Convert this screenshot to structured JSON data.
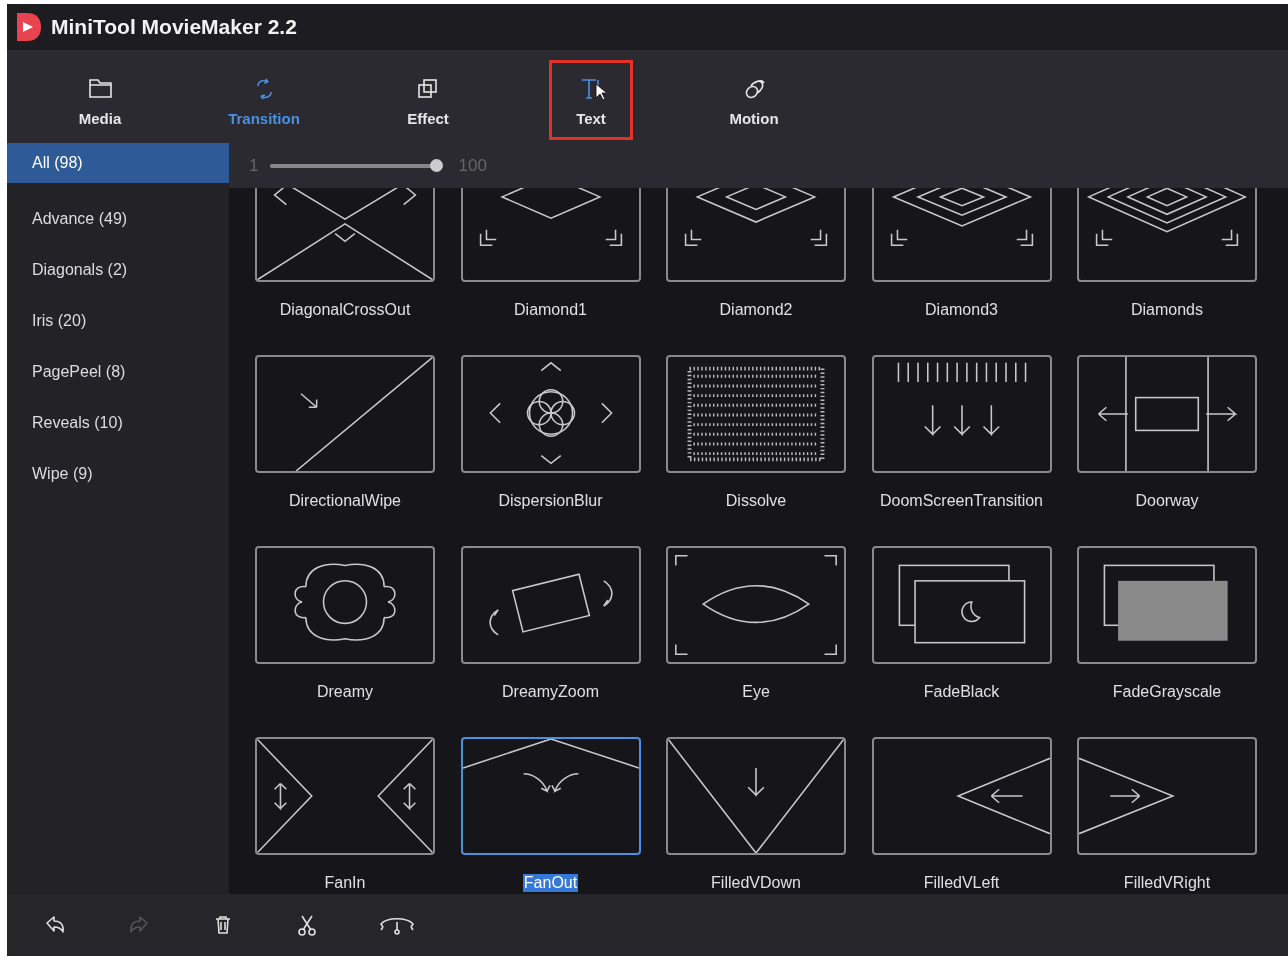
{
  "window": {
    "title": "MiniTool MovieMaker 2.2"
  },
  "tabs": [
    {
      "label": "Media",
      "kind": "folder",
      "selected": false,
      "highlighted": false
    },
    {
      "label": "Transition",
      "kind": "transition",
      "selected": true,
      "highlighted": false
    },
    {
      "label": "Effect",
      "kind": "effect",
      "selected": false,
      "highlighted": false
    },
    {
      "label": "Text",
      "kind": "text",
      "selected": false,
      "highlighted": true
    },
    {
      "label": "Motion",
      "kind": "motion",
      "selected": false,
      "highlighted": false
    }
  ],
  "sidebar": {
    "items": [
      {
        "label": "All (98)",
        "selected": true
      },
      {
        "label": "Advance (49)",
        "selected": false
      },
      {
        "label": "Diagonals (2)",
        "selected": false
      },
      {
        "label": "Iris (20)",
        "selected": false
      },
      {
        "label": "PagePeel (8)",
        "selected": false
      },
      {
        "label": "Reveals (10)",
        "selected": false
      },
      {
        "label": "Wipe (9)",
        "selected": false
      }
    ]
  },
  "zoom_slider": {
    "min_label": "1",
    "max_label": "100",
    "level": 0.98
  },
  "transitions": [
    {
      "name": "DiagonalCrossOut",
      "kind": "cross",
      "selected": false
    },
    {
      "name": "Diamond1",
      "kind": "diamond1",
      "selected": false
    },
    {
      "name": "Diamond2",
      "kind": "diamond2",
      "selected": false
    },
    {
      "name": "Diamond3",
      "kind": "diamond3",
      "selected": false
    },
    {
      "name": "Diamonds",
      "kind": "diamonds",
      "selected": false
    },
    {
      "name": "DirectionalWipe",
      "kind": "diagonal",
      "selected": false
    },
    {
      "name": "DispersionBlur",
      "kind": "flower",
      "selected": false
    },
    {
      "name": "Dissolve",
      "kind": "dots",
      "selected": false
    },
    {
      "name": "DoomScreenTransition",
      "kind": "doom",
      "selected": false
    },
    {
      "name": "Doorway",
      "kind": "doorway",
      "selected": false
    },
    {
      "name": "Dreamy",
      "kind": "gear",
      "selected": false
    },
    {
      "name": "DreamyZoom",
      "kind": "zoom",
      "selected": false
    },
    {
      "name": "Eye",
      "kind": "eye",
      "selected": false
    },
    {
      "name": "FadeBlack",
      "kind": "fadeblack",
      "selected": false
    },
    {
      "name": "FadeGrayscale",
      "kind": "fadegray",
      "selected": false
    },
    {
      "name": "FanIn",
      "kind": "fanin",
      "selected": false
    },
    {
      "name": "FanOut",
      "kind": "fanout",
      "selected": true
    },
    {
      "name": "FilledVDown",
      "kind": "vdown",
      "selected": false
    },
    {
      "name": "FilledVLeft",
      "kind": "vleft",
      "selected": false
    },
    {
      "name": "FilledVRight",
      "kind": "vright",
      "selected": false
    }
  ],
  "bottom_toolbar": [
    {
      "kind": "undo",
      "disabled": false
    },
    {
      "kind": "redo",
      "disabled": true
    },
    {
      "kind": "delete",
      "disabled": false
    },
    {
      "kind": "cut",
      "disabled": false
    },
    {
      "kind": "speed",
      "disabled": false
    }
  ]
}
